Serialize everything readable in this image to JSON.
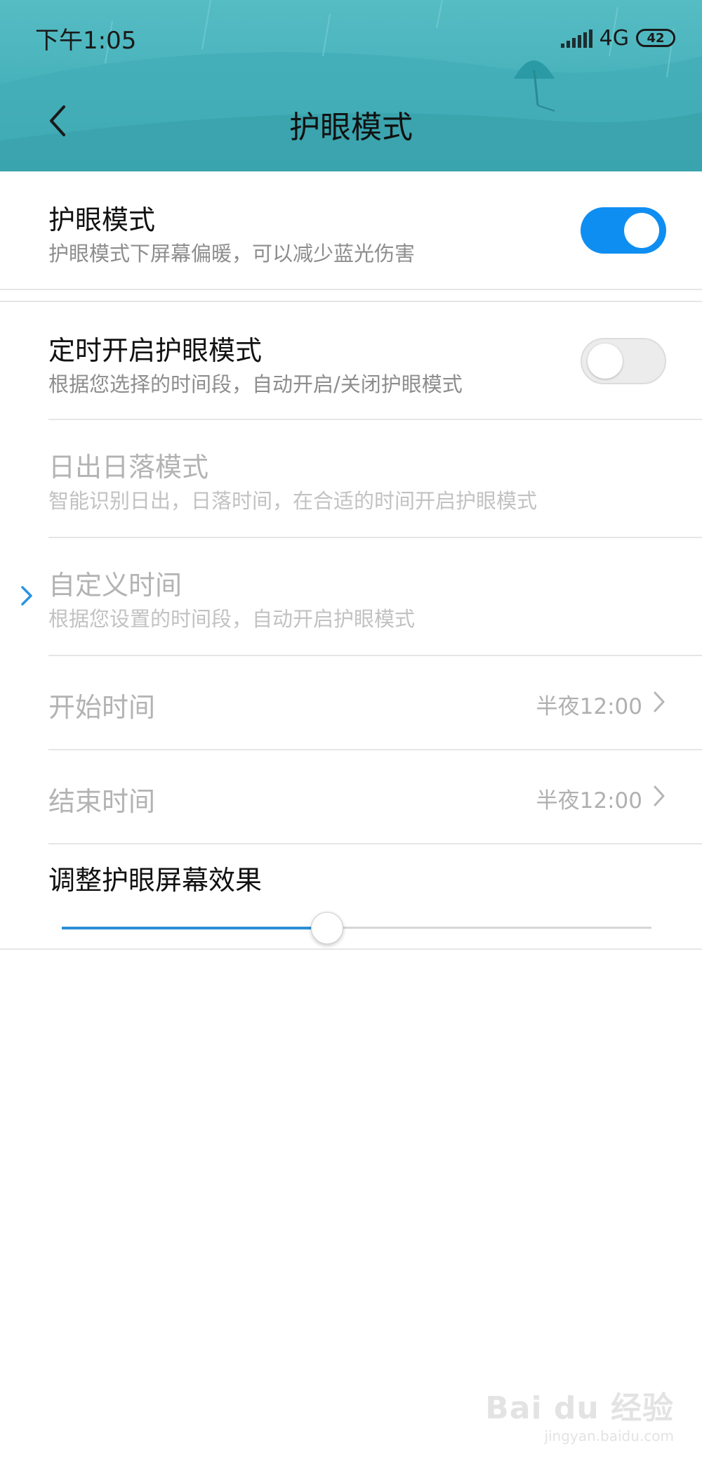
{
  "status_bar": {
    "time": "下午1:05",
    "network": "4G",
    "battery": "42"
  },
  "header": {
    "title": "护眼模式",
    "back_icon": "chevron-left-icon"
  },
  "settings": {
    "eye_mode": {
      "title": "护眼模式",
      "subtitle": "护眼模式下屏幕偏暖，可以减少蓝光伤害",
      "enabled": true
    },
    "schedule": {
      "title": "定时开启护眼模式",
      "subtitle": "根据您选择的时间段，自动开启/关闭护眼模式",
      "enabled": false
    },
    "sunrise_sunset": {
      "title": "日出日落模式",
      "subtitle": "智能识别日出，日落时间，在合适的时间开启护眼模式"
    },
    "custom_time": {
      "title": "自定义时间",
      "subtitle": "根据您设置的时间段，自动开启护眼模式"
    },
    "start_time": {
      "label": "开始时间",
      "value": "半夜12:00"
    },
    "end_time": {
      "label": "结束时间",
      "value": "半夜12:00"
    },
    "effect": {
      "label": "调整护眼屏幕效果",
      "level": 0.45
    }
  },
  "watermark": {
    "brand": "Bai du 经验",
    "url": "jingyan.baidu.com"
  },
  "colors": {
    "header": "#46b1ba",
    "accent": "#0f8ef2",
    "slider": "#2a8fd6"
  }
}
